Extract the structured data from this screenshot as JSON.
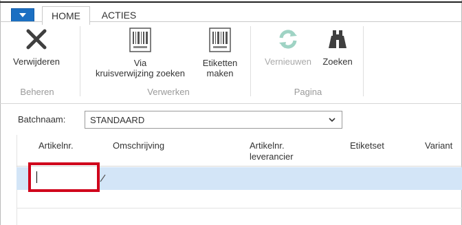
{
  "tabs": {
    "home": "HOME",
    "acties": "ACTIES"
  },
  "ribbon": {
    "beheren": {
      "group_label": "Beheren",
      "delete_label": "Verwijderen"
    },
    "verwerken": {
      "group_label": "Verwerken",
      "via_line1": "Via",
      "via_line2": "kruisverwijzing zoeken",
      "labels_line1": "Etiketten",
      "labels_line2": "maken"
    },
    "pagina": {
      "group_label": "Pagina",
      "refresh_label": "Vernieuwen",
      "find_label": "Zoeken"
    }
  },
  "batch": {
    "label": "Batchnaam:",
    "value": "STANDAARD"
  },
  "grid": {
    "columns": [
      {
        "line1": "Artikelnr.",
        "line2": ""
      },
      {
        "line1": "Omschrijving",
        "line2": ""
      },
      {
        "line1": "Artikelnr.",
        "line2": "leverancier"
      },
      {
        "line1": "Etiketset",
        "line2": ""
      },
      {
        "line1": "Variant",
        "line2": ""
      }
    ],
    "rows": [
      {
        "artikelnr": "",
        "omschrijving": "",
        "leverancier": "",
        "etiketset": "",
        "variant": ""
      }
    ]
  },
  "colors": {
    "accent": "#1b6fc2",
    "selected_row": "#d3e5f7",
    "highlight": "#d0021b",
    "disabled_text": "#a9a9a9"
  },
  "icons": {
    "app_menu": "caret-down-icon",
    "delete": "x-icon",
    "via_cross_ref": "barcode-icon",
    "labels": "barcode-icon",
    "refresh": "refresh-icon",
    "find": "binoculars-icon",
    "batch_dropdown": "chevron-down-icon"
  }
}
